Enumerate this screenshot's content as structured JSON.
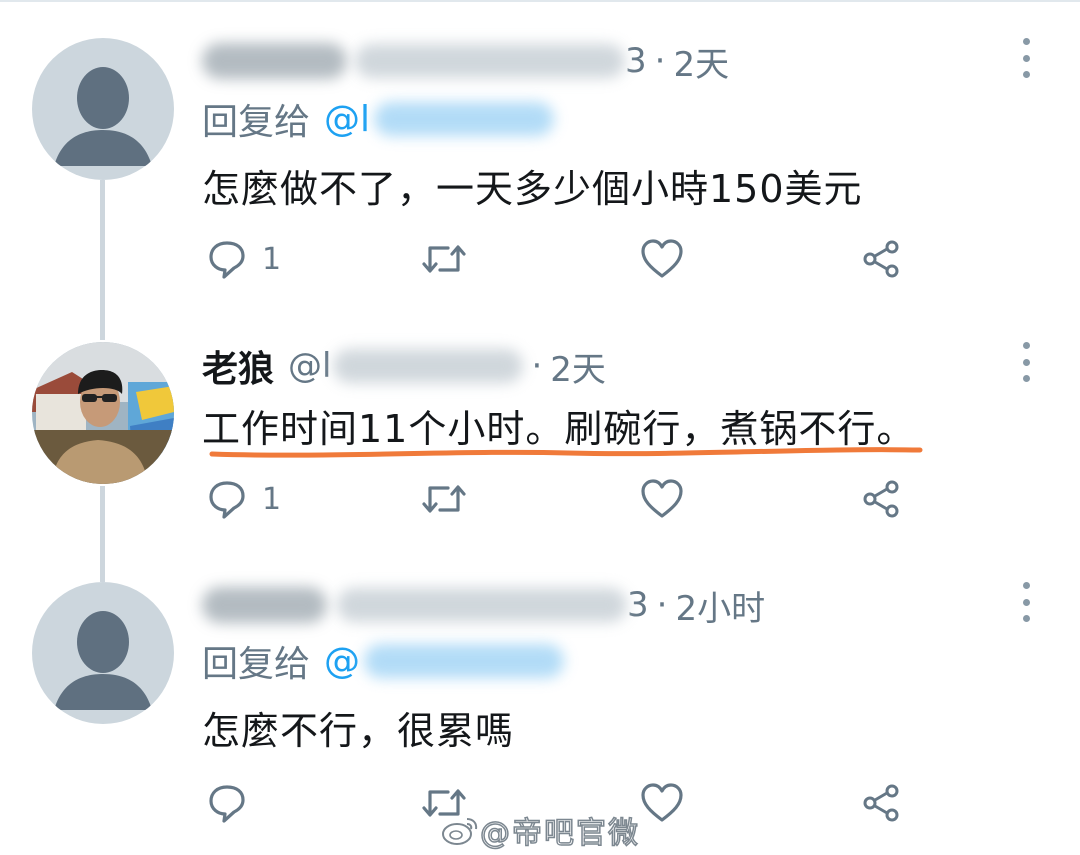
{
  "tweets": [
    {
      "display_name": "",
      "handle_suffix": "3",
      "time": "2天",
      "reply_label": "回复给",
      "reply_mention": "@l",
      "text": "怎麼做不了，一天多少個小時150美元",
      "reply_count": "1",
      "avatar": "default-avatar"
    },
    {
      "display_name": "老狼",
      "handle_prefix": "@l",
      "time": "2天",
      "text": "工作时间11个小时。刷碗行，煮锅不行。",
      "reply_count": "1",
      "avatar": "profile-photo"
    },
    {
      "display_name": "",
      "handle_suffix": "3",
      "time": "2小时",
      "reply_label": "回复给",
      "reply_mention": "@",
      "text": "怎麼不行，很累嗎",
      "reply_count": "",
      "avatar": "default-avatar"
    }
  ],
  "separator": "·",
  "icons": {
    "reply": "reply-icon",
    "retweet": "retweet-icon",
    "like": "heart-icon",
    "share": "share-icon",
    "more": "more-vertical-icon"
  },
  "colors": {
    "text": "#14171a",
    "muted": "#657786",
    "link": "#1da1f2",
    "underline": "#f07a3a",
    "thread_line": "#cdd6dd"
  },
  "watermark": "@帝吧官微"
}
